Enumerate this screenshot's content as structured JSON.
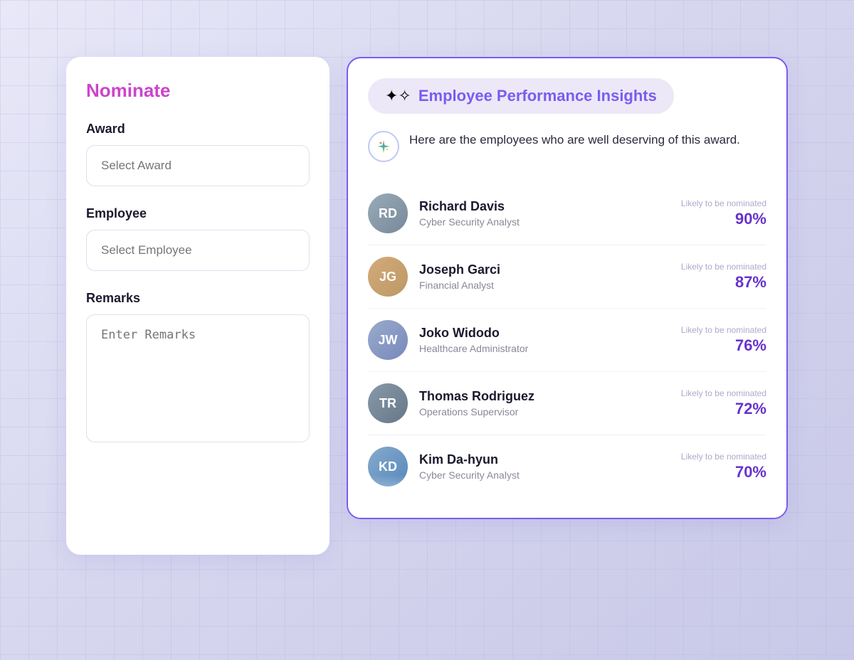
{
  "background": {
    "gradient_start": "#e8e8f8",
    "gradient_end": "#c8c8e8"
  },
  "nominate": {
    "title": "Nominate",
    "award_label": "Award",
    "award_placeholder": "Select Award",
    "employee_label": "Employee",
    "employee_placeholder": "Select Employee",
    "remarks_label": "Remarks",
    "remarks_placeholder": "Enter Remarks"
  },
  "insights": {
    "title": "Employee Performance Insights",
    "description": "Here are the employees who are well deserving of this award.",
    "sparkle_icon": "✦",
    "employees": [
      {
        "name": "Richard Davis",
        "role": "Cyber Security Analyst",
        "score": "90%",
        "score_label": "Likely to be nominated",
        "avatar_letter": "RD",
        "avatar_class": "avatar-1"
      },
      {
        "name": "Joseph Garci",
        "role": "Financial Analyst",
        "score": "87%",
        "score_label": "Likely to be nominated",
        "avatar_letter": "JG",
        "avatar_class": "avatar-2"
      },
      {
        "name": "Joko Widodo",
        "role": "Healthcare Administrator",
        "score": "76%",
        "score_label": "Likely to be nominated",
        "avatar_letter": "JW",
        "avatar_class": "avatar-3"
      },
      {
        "name": "Thomas Rodriguez",
        "role": "Operations Supervisor",
        "score": "72%",
        "score_label": "Likely to be nominated",
        "avatar_letter": "TR",
        "avatar_class": "avatar-4"
      },
      {
        "name": "Kim Da-hyun",
        "role": "Cyber Security Analyst",
        "score": "70%",
        "score_label": "Likely to be nominated",
        "avatar_letter": "KD",
        "avatar_class": "avatar-5"
      }
    ]
  }
}
